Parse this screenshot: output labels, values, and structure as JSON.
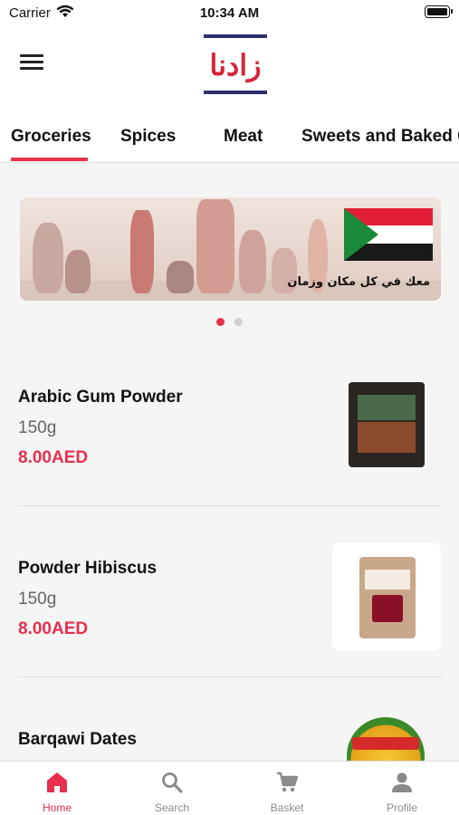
{
  "status_bar": {
    "carrier": "Carrier",
    "time": "10:34 AM"
  },
  "app_bar": {
    "logo_text": "زادنا"
  },
  "tabs": [
    {
      "label": "Groceries",
      "active": true
    },
    {
      "label": "Spices"
    },
    {
      "label": "Meat"
    },
    {
      "label": "Sweets and Baked G"
    }
  ],
  "banner": {
    "tagline": "معك في كل مكان وزمان",
    "slide_index": 1,
    "slide_count": 2
  },
  "products": [
    {
      "name": "Arabic Gum Powder",
      "weight": "150g",
      "price": "8.00AED"
    },
    {
      "name": "Powder Hibiscus",
      "weight": "150g",
      "price": "8.00AED"
    },
    {
      "name": "Barqawi Dates"
    }
  ],
  "bottom_nav": [
    {
      "label": "Home",
      "icon": "home-icon",
      "active": true
    },
    {
      "label": "Search",
      "icon": "search-icon"
    },
    {
      "label": "Basket",
      "icon": "cart-icon"
    },
    {
      "label": "Profile",
      "icon": "profile-icon"
    }
  ],
  "colors": {
    "accent": "#e8304c",
    "logo_red": "#d6243a",
    "logo_navy": "#2e2e6e",
    "inactive": "#8a8a8a"
  }
}
